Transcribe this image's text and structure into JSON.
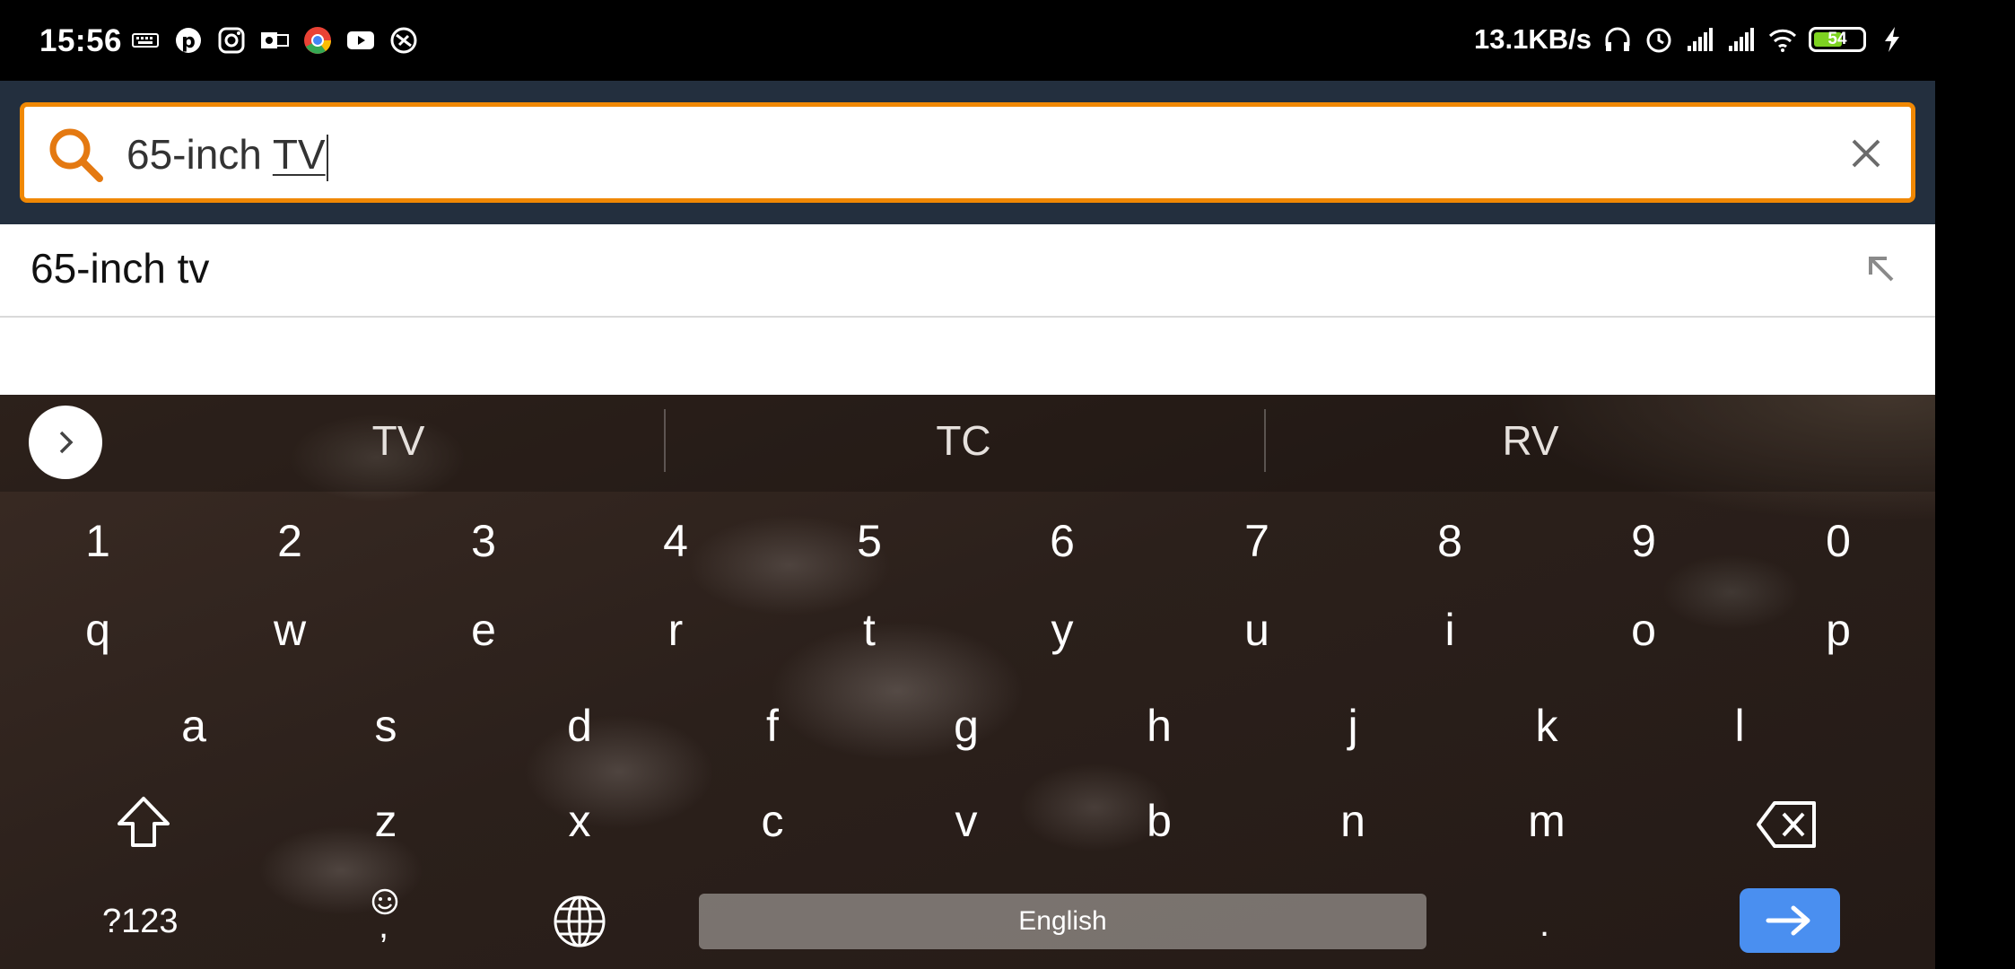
{
  "status_bar": {
    "time": "15:56",
    "speed": "13.1KB/s",
    "battery": "54",
    "left_icons": [
      "keyboard-icon",
      "pinterest-icon",
      "instagram-icon",
      "outlook-icon",
      "chrome-icon",
      "youtube-icon",
      "vpn-icon"
    ],
    "right_icons": [
      "headphones-icon",
      "alarm-icon",
      "signal-icon",
      "signal-icon",
      "wifi-icon",
      "battery-icon",
      "charging-icon"
    ]
  },
  "search": {
    "typed_prefix": "65-inch ",
    "composing": "TV",
    "accent_color": "#f08804",
    "header_color": "#232f3e"
  },
  "suggestions": [
    {
      "text": "65-inch tv"
    }
  ],
  "keyboard": {
    "word_suggestions": [
      "TV",
      "TC",
      "RV"
    ],
    "number_row": [
      "1",
      "2",
      "3",
      "4",
      "5",
      "6",
      "7",
      "8",
      "9",
      "0"
    ],
    "row1": [
      "q",
      "w",
      "e",
      "r",
      "t",
      "y",
      "u",
      "i",
      "o",
      "p"
    ],
    "row2": [
      "a",
      "s",
      "d",
      "f",
      "g",
      "h",
      "j",
      "k",
      "l"
    ],
    "row3": [
      "z",
      "x",
      "c",
      "v",
      "b",
      "n",
      "m"
    ],
    "symbols_label": "?123",
    "comma_label": ",",
    "space_label": "English",
    "period_label": ".",
    "enter_color": "#4a8ff0"
  }
}
